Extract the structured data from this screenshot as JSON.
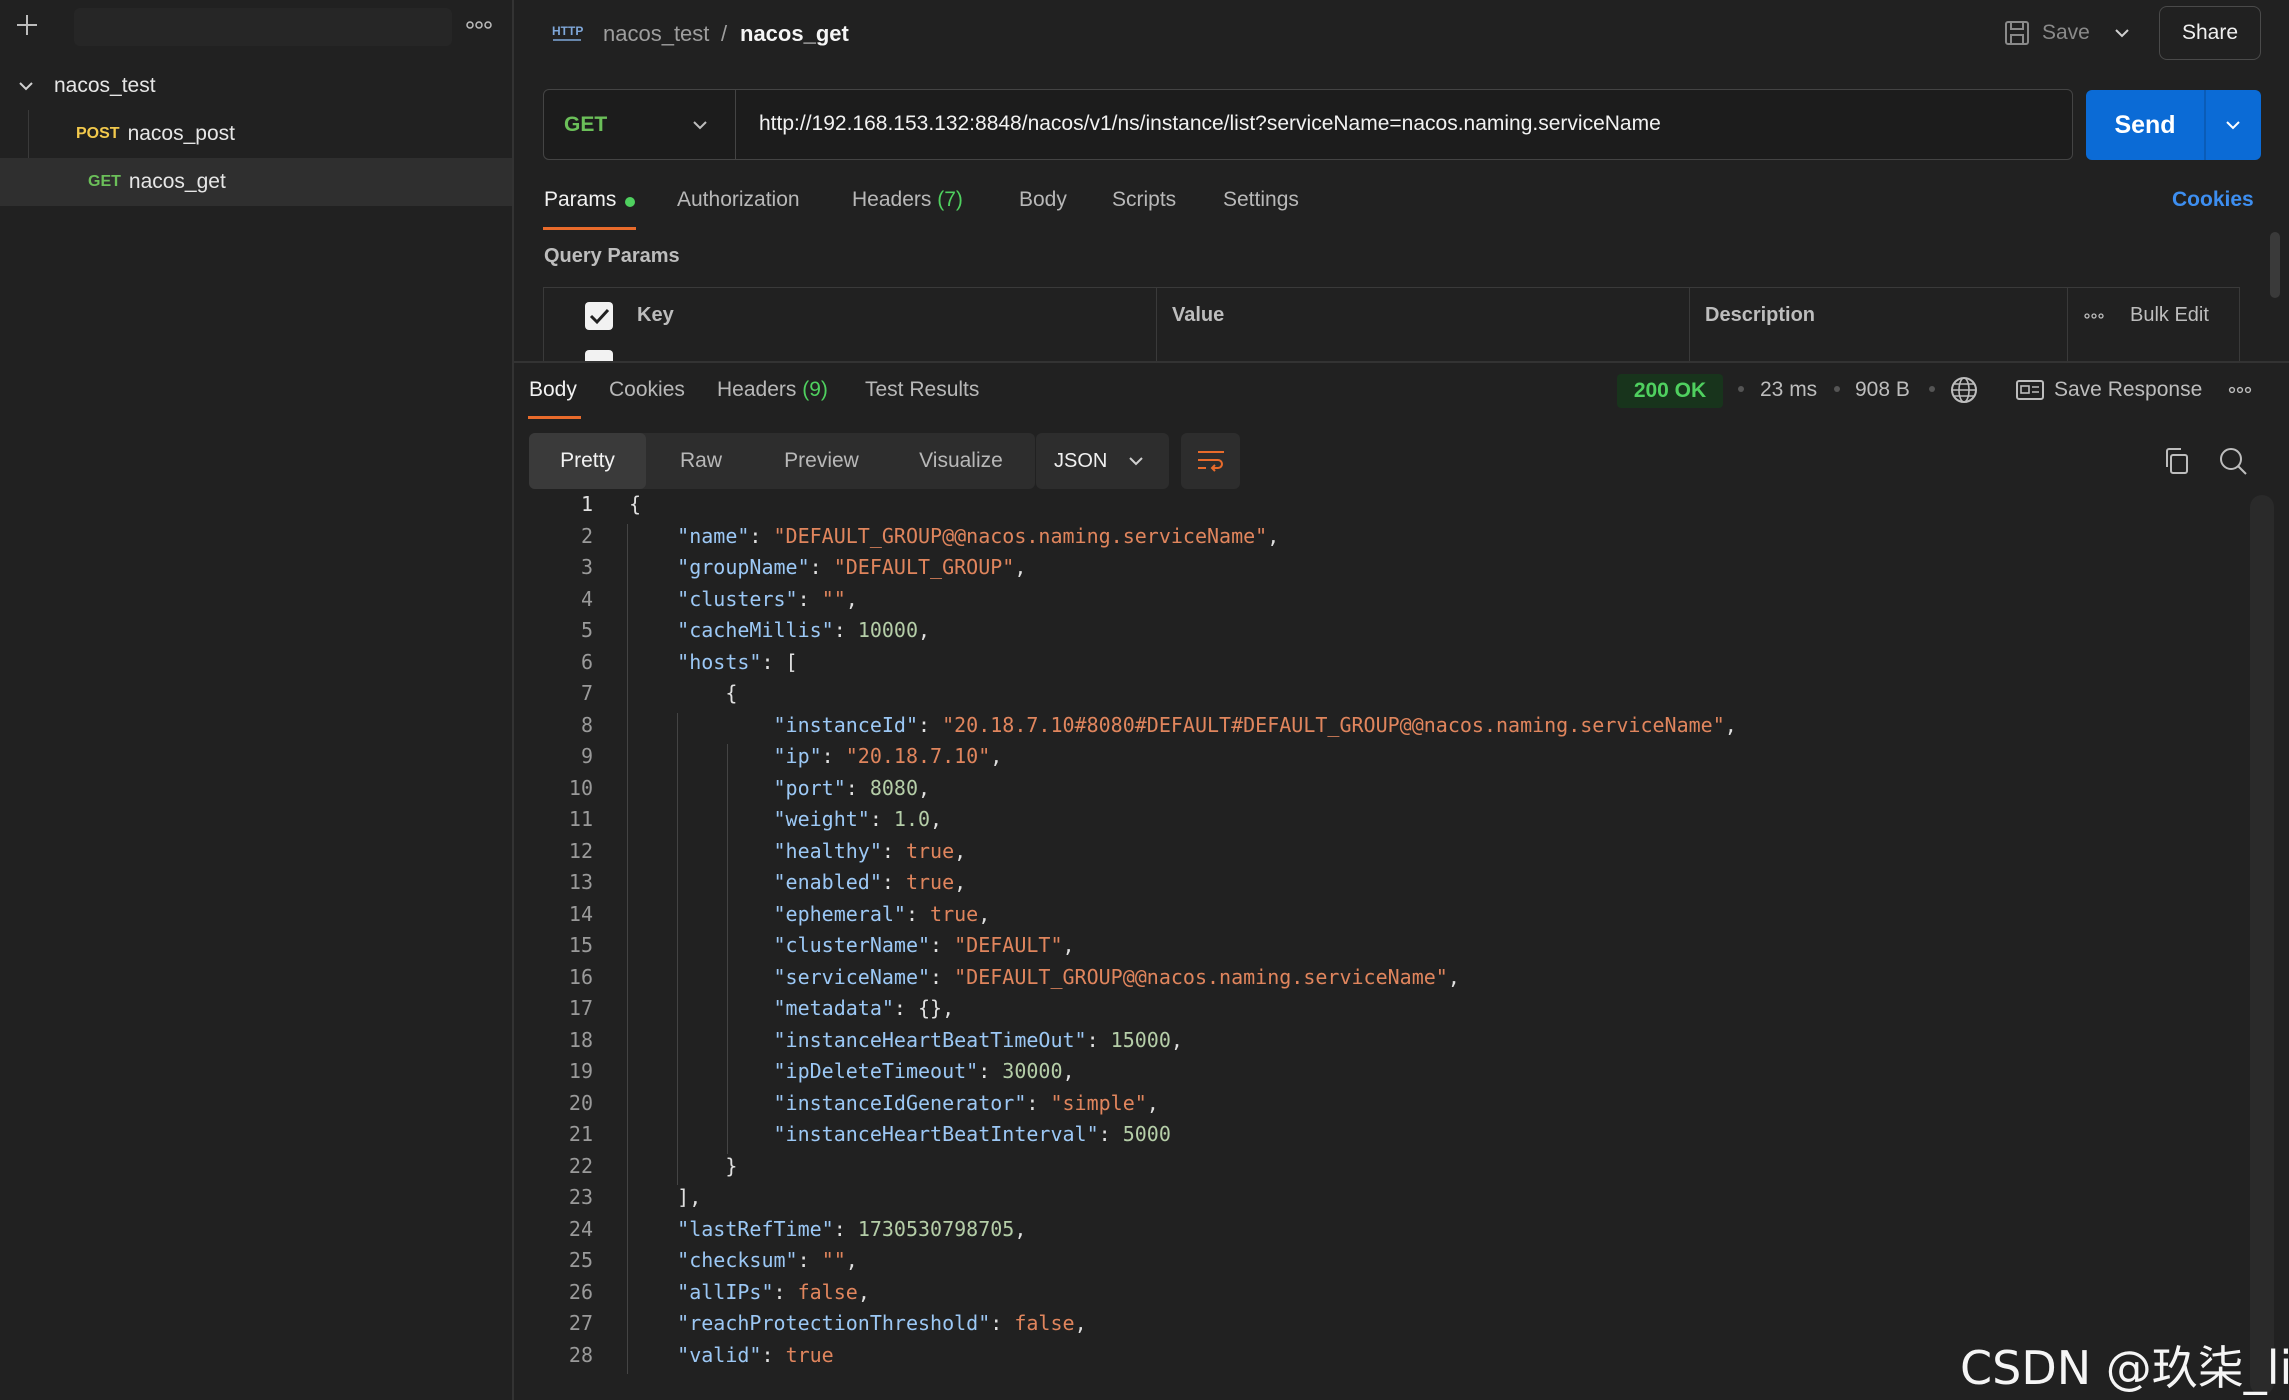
{
  "sidebar": {
    "collection": "nacos_test",
    "items": [
      {
        "method": "POST",
        "label": "nacos_post",
        "method_color": "#f2c94c"
      },
      {
        "method": "GET",
        "label": "nacos_get",
        "method_color": "#6bbf59"
      }
    ]
  },
  "header": {
    "collection": "nacos_test",
    "separator": "/",
    "request_name": "nacos_get",
    "save_label": "Save",
    "share_label": "Share"
  },
  "request": {
    "method": "GET",
    "url": "http://192.168.153.132:8848/nacos/v1/ns/instance/list?serviceName=nacos.naming.serviceName",
    "send_label": "Send"
  },
  "request_tabs": {
    "params": "Params",
    "authorization": "Authorization",
    "headers": "Headers",
    "headers_count": "(7)",
    "body": "Body",
    "scripts": "Scripts",
    "settings": "Settings",
    "cookies": "Cookies"
  },
  "query_params": {
    "title": "Query Params",
    "columns": {
      "key": "Key",
      "value": "Value",
      "description": "Description"
    },
    "bulk_edit": "Bulk Edit"
  },
  "response": {
    "tabs": {
      "body": "Body",
      "cookies": "Cookies",
      "headers": "Headers",
      "headers_count": "(9)",
      "test_results": "Test Results"
    },
    "status": "200 OK",
    "time": "23 ms",
    "size": "908 B",
    "save_response": "Save Response",
    "views": {
      "pretty": "Pretty",
      "raw": "Raw",
      "preview": "Preview",
      "visualize": "Visualize"
    },
    "format": "JSON"
  },
  "code_lines": [
    "{",
    "    \"name\": \"DEFAULT_GROUP@@nacos.naming.serviceName\",",
    "    \"groupName\": \"DEFAULT_GROUP\",",
    "    \"clusters\": \"\",",
    "    \"cacheMillis\": 10000,",
    "    \"hosts\": [",
    "        {",
    "            \"instanceId\": \"20.18.7.10#8080#DEFAULT#DEFAULT_GROUP@@nacos.naming.serviceName\",",
    "            \"ip\": \"20.18.7.10\",",
    "            \"port\": 8080,",
    "            \"weight\": 1.0,",
    "            \"healthy\": true,",
    "            \"enabled\": true,",
    "            \"ephemeral\": true,",
    "            \"clusterName\": \"DEFAULT\",",
    "            \"serviceName\": \"DEFAULT_GROUP@@nacos.naming.serviceName\",",
    "            \"metadata\": {},",
    "            \"instanceHeartBeatTimeOut\": 15000,",
    "            \"ipDeleteTimeout\": 30000,",
    "            \"instanceIdGenerator\": \"simple\",",
    "            \"instanceHeartBeatInterval\": 5000",
    "        }",
    "    ],",
    "    \"lastRefTime\": 1730530798705,",
    "    \"checksum\": \"\",",
    "    \"allIPs\": false,",
    "    \"reachProtectionThreshold\": false,",
    "    \"valid\": true"
  ],
  "watermark": "CSDN @玖柒_lin"
}
